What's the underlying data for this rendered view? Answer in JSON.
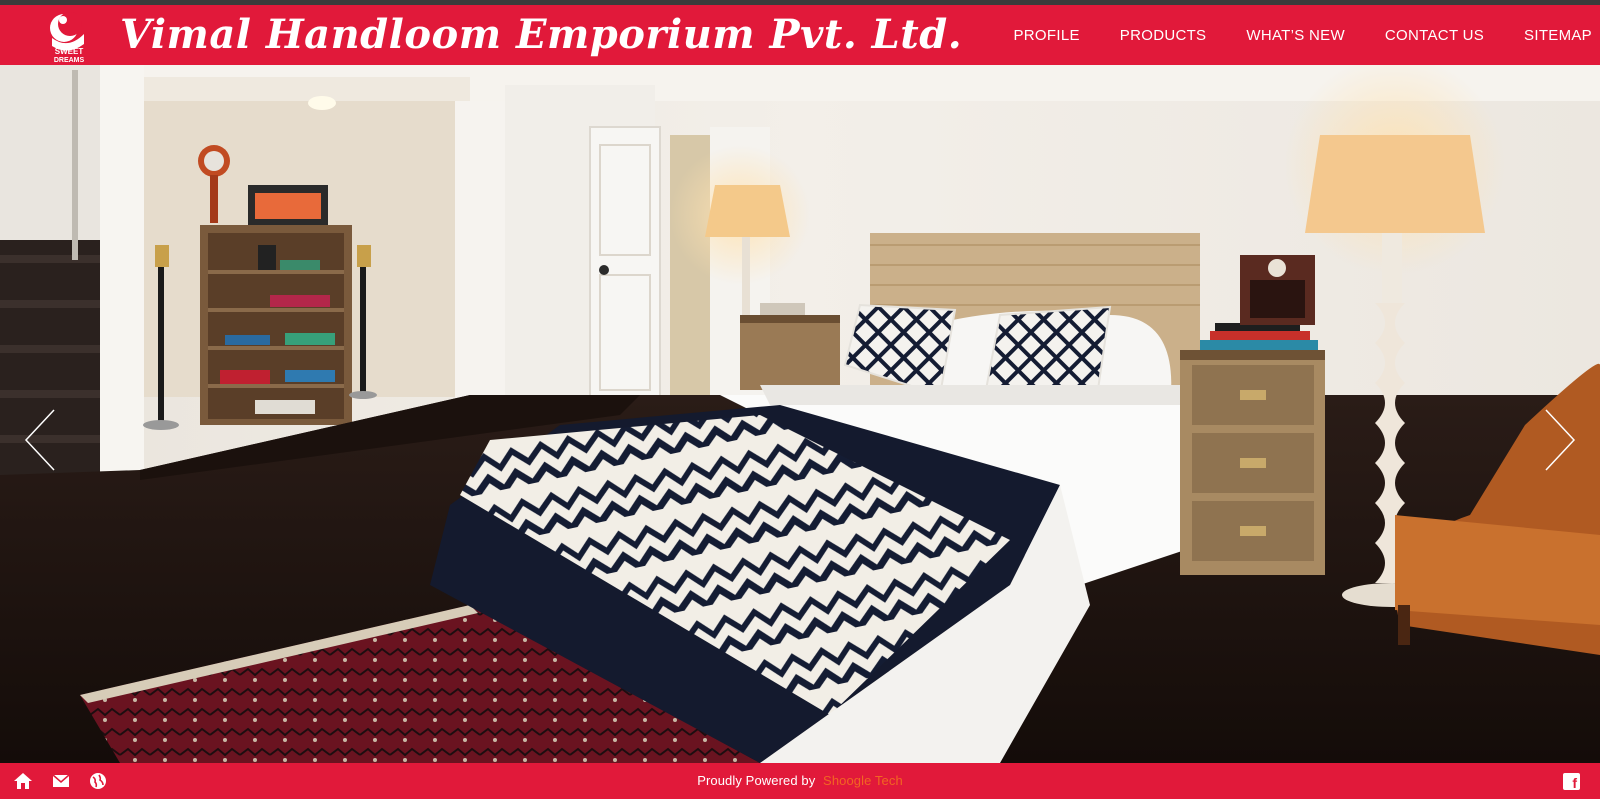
{
  "header": {
    "brand": "Vimal Handloom Emporium Pvt. Ltd.",
    "logo_text_top": "SWEET",
    "logo_text_bottom": "DREAMS",
    "nav": [
      {
        "label": "PROFILE"
      },
      {
        "label": "PRODUCTS"
      },
      {
        "label": "WHAT’S NEW"
      },
      {
        "label": "CONTACT US"
      },
      {
        "label": "SITEMAP"
      }
    ]
  },
  "slider": {
    "image": "bedroom-interior-photo",
    "prev_icon": "chevron-left-icon",
    "next_icon": "chevron-right-icon"
  },
  "footer": {
    "powered_text": "Proudly Powered by",
    "powered_link": "Shoogle Tech",
    "icons": [
      "home-icon",
      "mail-icon",
      "globe-icon",
      "facebook-icon"
    ]
  },
  "colors": {
    "brand_red": "#e1193a",
    "top_strip": "#3b3b3b",
    "link_orange": "#f26522"
  }
}
